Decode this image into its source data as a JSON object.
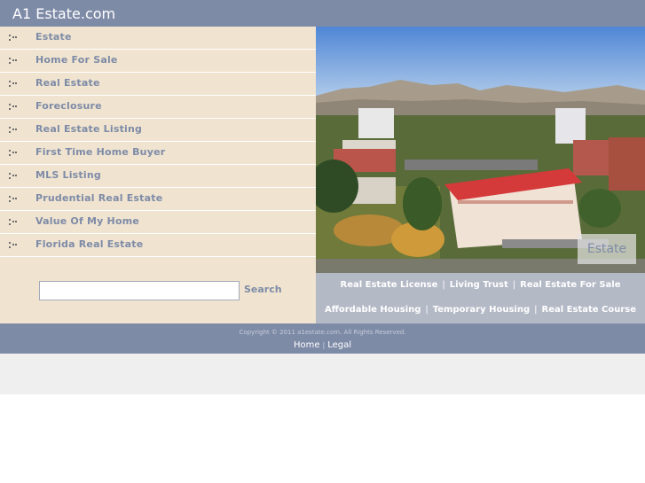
{
  "header": {
    "title": "A1 Estate.com"
  },
  "nav": {
    "items": [
      {
        "label": "Estate"
      },
      {
        "label": "Home For Sale"
      },
      {
        "label": "Real Estate"
      },
      {
        "label": "Foreclosure"
      },
      {
        "label": "Real Estate Listing"
      },
      {
        "label": "First Time Home Buyer"
      },
      {
        "label": "MLS Listing"
      },
      {
        "label": "Prudential Real Estate"
      },
      {
        "label": "Value Of My Home"
      },
      {
        "label": "Florida Real Estate"
      }
    ]
  },
  "search": {
    "value": "",
    "button_label": "Search"
  },
  "photo": {
    "caption": "Estate"
  },
  "links": {
    "row1": [
      "Real Estate License",
      "Living Trust",
      "Real Estate For Sale"
    ],
    "row2": [
      "Affordable Housing",
      "Temporary Housing",
      "Real Estate Course"
    ],
    "separator": "|"
  },
  "footer": {
    "copyright": "Copyright © 2011 a1estate.com. All Rights Reserved.",
    "home_label": "Home",
    "legal_label": "Legal",
    "separator": "|"
  },
  "colors": {
    "header_bg": "#7e8ba7",
    "sidebar_bg": "#f0e4d0",
    "link_text": "#7e8ba7",
    "links_panel_bg": "#b4b9c6"
  }
}
